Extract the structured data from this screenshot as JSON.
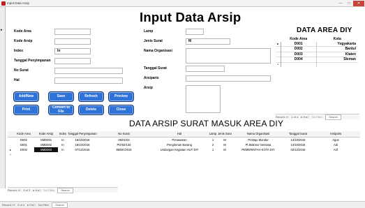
{
  "window": {
    "title": "Input Data Arsip",
    "minimize": "—",
    "maximize": "□",
    "close": "✕"
  },
  "form": {
    "title": "Input Data Arsip",
    "fields_left": [
      {
        "label": "Kode Area",
        "value": ""
      },
      {
        "label": "Kode Arsip",
        "value": ""
      },
      {
        "label": "Index",
        "value": "In"
      },
      {
        "label": "Tanggal Penyimpanan",
        "value": ""
      },
      {
        "label": "No Surat",
        "value": ""
      },
      {
        "label": "Hal",
        "value": ""
      }
    ],
    "fields_right": [
      {
        "label": "Lamp",
        "value": ""
      },
      {
        "label": "Jenis Surat",
        "value": "M"
      },
      {
        "label": "Nama Organisasi",
        "value": ""
      },
      {
        "label": "Tanggal Surat",
        "value": ""
      },
      {
        "label": "Arsiparis",
        "value": ""
      },
      {
        "label": "Arsip",
        "value": ""
      }
    ],
    "buttons": {
      "add_new": "Add/New",
      "save": "Save",
      "refresh": "Refresh",
      "preview": "Preview",
      "print": "Print",
      "convert_line1": "Convert to",
      "convert_line2": "File",
      "delete": "Delete",
      "close": "Close"
    }
  },
  "area_panel": {
    "title": "DATA AREA DIY",
    "columns": [
      "Kode Area",
      "Kota"
    ],
    "rows": [
      {
        "kode": "D001",
        "kota": "Yogyakarta"
      },
      {
        "kode": "D002",
        "kota": "Bantul"
      },
      {
        "kode": "D003",
        "kota": "Klaten"
      },
      {
        "kode": "D004",
        "kota": "Sleman"
      }
    ],
    "nav": {
      "record": "Record: H",
      "position": "1 of 4",
      "controls": "▸ H ▸□",
      "filter": "No Filter",
      "search": "Search"
    }
  },
  "grid": {
    "title": "DATA ARSIP SURAT MASUK AREA DIY",
    "columns": [
      "Kode Area",
      "Kode Arsip",
      "Index",
      "Tanggal Penyimpanan",
      "No Surat",
      "Hal",
      "Lamp",
      "Jenis Surat",
      "Nama Organisasi",
      "Tanggal Surat",
      "Arsiparis"
    ],
    "rows": [
      [
        "D002",
        "SMD001",
        "In",
        "16/10/2016",
        "06/01/02",
        "Penawaran",
        "1",
        "M",
        "Pt.Maju Mundur",
        "14/10/2016",
        "Agus"
      ],
      [
        "D001",
        "SMD002",
        "In",
        "18/10/2016",
        "PO/02/134",
        "Pengiriman Barang",
        "2",
        "M",
        "Pt.Makmur Sentosa",
        "14/10/2016",
        "Adi"
      ],
      [
        "D002",
        "SMD003",
        "In",
        "07/12/2016",
        "68/DK/2016",
        "Undangan Kegiatan HUT DIY",
        "1",
        "M",
        "PEMERINTAH KOTA DIY",
        "02/12/2016",
        "Arif"
      ]
    ],
    "nav": {
      "record": "Record: H",
      "position": "3 of 3",
      "controls": "▸ H ▸□",
      "filter": "No Filter",
      "search": "Search"
    }
  },
  "status": {
    "record": "Record: H",
    "position": "4 of 4",
    "controls": "▸ H ▸□",
    "filter": "No Filter",
    "search": "Search"
  }
}
